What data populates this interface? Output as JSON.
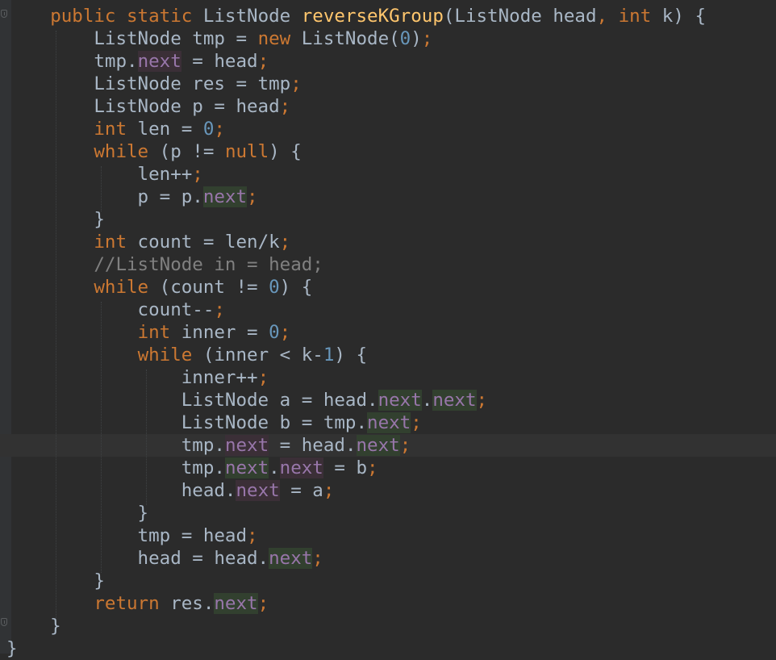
{
  "editor": {
    "language": "Java",
    "theme": "Darcula",
    "highlighted_line": 20,
    "colors": {
      "background": "#2b2b2b",
      "keyword": "#cc7832",
      "number": "#6897bb",
      "method": "#ffc66d",
      "field": "#9876aa",
      "comment": "#808080",
      "text": "#a9b7c6"
    },
    "code_lines": [
      [
        {
          "t": "    "
        },
        {
          "t": "public",
          "c": "kw"
        },
        {
          "t": " "
        },
        {
          "t": "static",
          "c": "kw"
        },
        {
          "t": " ListNode "
        },
        {
          "t": "reverseKGroup",
          "c": "fn"
        },
        {
          "t": "(ListNode head"
        },
        {
          "t": ",",
          "c": "kw"
        },
        {
          "t": " "
        },
        {
          "t": "int",
          "c": "kw"
        },
        {
          "t": " k) {"
        }
      ],
      [
        {
          "t": "        ListNode tmp = "
        },
        {
          "t": "new",
          "c": "kw"
        },
        {
          "t": " ListNode("
        },
        {
          "t": "0",
          "c": "num"
        },
        {
          "t": ")"
        },
        {
          "t": ";",
          "c": "kw"
        }
      ],
      [
        {
          "t": "        tmp."
        },
        {
          "t": "next",
          "c": "field hl-r"
        },
        {
          "t": " = head"
        },
        {
          "t": ";",
          "c": "kw"
        }
      ],
      [
        {
          "t": "        ListNode res = tmp"
        },
        {
          "t": ";",
          "c": "kw"
        }
      ],
      [
        {
          "t": "        ListNode p = head"
        },
        {
          "t": ";",
          "c": "kw"
        }
      ],
      [
        {
          "t": "        "
        },
        {
          "t": "int",
          "c": "kw"
        },
        {
          "t": " len = "
        },
        {
          "t": "0",
          "c": "num"
        },
        {
          "t": ";",
          "c": "kw"
        }
      ],
      [
        {
          "t": "        "
        },
        {
          "t": "while",
          "c": "kw"
        },
        {
          "t": " (p != "
        },
        {
          "t": "null",
          "c": "kw"
        },
        {
          "t": ") {"
        }
      ],
      [
        {
          "t": "            len++"
        },
        {
          "t": ";",
          "c": "kw"
        }
      ],
      [
        {
          "t": "            p = p."
        },
        {
          "t": "next",
          "c": "field hl-w"
        },
        {
          "t": ";",
          "c": "kw"
        }
      ],
      [
        {
          "t": "        }"
        }
      ],
      [
        {
          "t": "        "
        },
        {
          "t": "int",
          "c": "kw"
        },
        {
          "t": " count = len/k"
        },
        {
          "t": ";",
          "c": "kw"
        }
      ],
      [
        {
          "t": "        "
        },
        {
          "t": "//ListNode in = head;",
          "c": "cm"
        }
      ],
      [
        {
          "t": "        "
        },
        {
          "t": "while",
          "c": "kw"
        },
        {
          "t": " (count != "
        },
        {
          "t": "0",
          "c": "num"
        },
        {
          "t": ") {"
        }
      ],
      [
        {
          "t": "            count--"
        },
        {
          "t": ";",
          "c": "kw"
        }
      ],
      [
        {
          "t": "            "
        },
        {
          "t": "int",
          "c": "kw"
        },
        {
          "t": " inner = "
        },
        {
          "t": "0",
          "c": "num"
        },
        {
          "t": ";",
          "c": "kw"
        }
      ],
      [
        {
          "t": "            "
        },
        {
          "t": "while",
          "c": "kw"
        },
        {
          "t": " (inner < k-"
        },
        {
          "t": "1",
          "c": "num"
        },
        {
          "t": ") {"
        }
      ],
      [
        {
          "t": "                inner++"
        },
        {
          "t": ";",
          "c": "kw"
        }
      ],
      [
        {
          "t": "                ListNode a = head."
        },
        {
          "t": "next",
          "c": "field hl-w"
        },
        {
          "t": "."
        },
        {
          "t": "next",
          "c": "field hl-w"
        },
        {
          "t": ";",
          "c": "kw"
        }
      ],
      [
        {
          "t": "                ListNode b = tmp."
        },
        {
          "t": "next",
          "c": "field hl-w"
        },
        {
          "t": ";",
          "c": "kw"
        }
      ],
      [
        {
          "t": "                tmp."
        },
        {
          "t": "next",
          "c": "field hl-r"
        },
        {
          "t": " = head."
        },
        {
          "t": "next",
          "c": "field hl-w"
        },
        {
          "t": ";",
          "c": "kw"
        }
      ],
      [
        {
          "t": "                tmp."
        },
        {
          "t": "next",
          "c": "field hl-w"
        },
        {
          "t": "."
        },
        {
          "t": "next",
          "c": "field hl-r"
        },
        {
          "t": " = b"
        },
        {
          "t": ";",
          "c": "kw"
        }
      ],
      [
        {
          "t": "                head."
        },
        {
          "t": "next",
          "c": "field hl-r"
        },
        {
          "t": " = a"
        },
        {
          "t": ";",
          "c": "kw"
        }
      ],
      [
        {
          "t": "            }"
        }
      ],
      [
        {
          "t": "            tmp = head"
        },
        {
          "t": ";",
          "c": "kw"
        }
      ],
      [
        {
          "t": "            head = head."
        },
        {
          "t": "next",
          "c": "field hl-w"
        },
        {
          "t": ";",
          "c": "kw"
        }
      ],
      [
        {
          "t": "        }"
        }
      ],
      [
        {
          "t": "        "
        },
        {
          "t": "return",
          "c": "kw"
        },
        {
          "t": " res."
        },
        {
          "t": "next",
          "c": "field hl-w"
        },
        {
          "t": ";",
          "c": "kw"
        }
      ],
      [
        {
          "t": "    }"
        }
      ],
      [
        {
          "t": "}"
        }
      ]
    ]
  }
}
